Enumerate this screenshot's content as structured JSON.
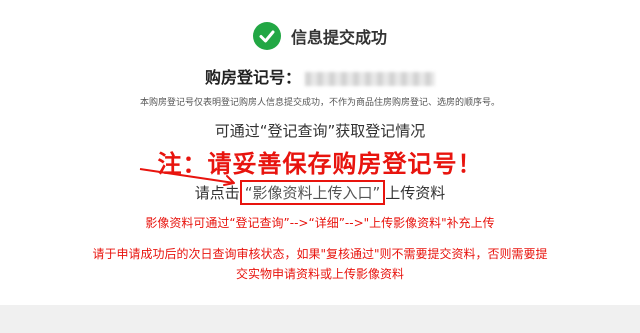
{
  "header": {
    "title": "信息提交成功",
    "icon": "check-circle-icon",
    "accent": "#22a744"
  },
  "registration": {
    "label": "购房登记号："
  },
  "disclaimer": "本购房登记号仅表明登记购房人信息提交成功，不作为商品住房购房登记、选房的顺序号。",
  "query_text": "可通过“登记查询”获取登记情况",
  "warning": "注：请妥善保存购房登记号！",
  "upload": {
    "prefix": "请点击",
    "link": "“影像资料上传入口”",
    "suffix": "上传资料"
  },
  "notes": {
    "note1": "影像资料可通过“登记查询”-->“详细”-->\"上传影像资料\"补充上传",
    "note2": "请于申请成功后的次日查询审核状态，如果\"复核通过\"则不需要提交资料，否则需要提交实物申请资料或上传影像资料"
  },
  "colors": {
    "warning_red": "#e8140e"
  }
}
